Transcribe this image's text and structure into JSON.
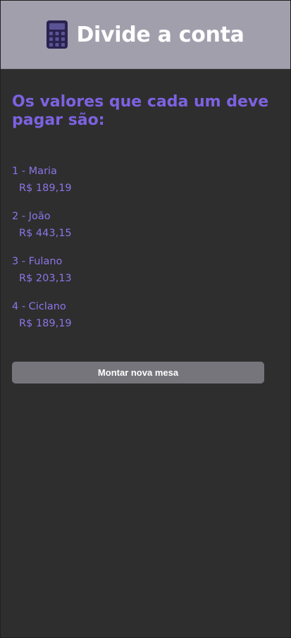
{
  "header": {
    "title": "Divide a conta",
    "icon": "calculator-icon",
    "background_color": "#a29fad"
  },
  "main": {
    "heading": "Os valores que cada um deve pagar são:",
    "accent_color": "#7d62e0",
    "people": [
      {
        "label": "1 - Maria",
        "amount": "R$ 189,19"
      },
      {
        "label": "2 - João",
        "amount": "R$ 443,15"
      },
      {
        "label": "3 - Fulano",
        "amount": "R$ 203,13"
      },
      {
        "label": "4 - Ciclano",
        "amount": "R$ 189,19"
      }
    ],
    "new_table_button": "Montar nova mesa"
  }
}
